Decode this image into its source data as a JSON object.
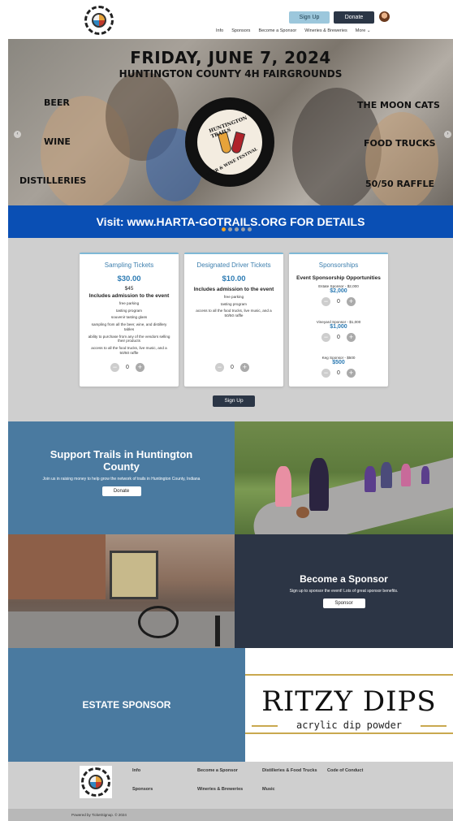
{
  "header": {
    "signup_label": "Sign Up",
    "donate_label": "Donate",
    "nav": [
      "Info",
      "Sponsors",
      "Become a Sponsor",
      "Wineries & Breweries",
      "More ⌄"
    ]
  },
  "hero": {
    "title": "FRIDAY, JUNE  7, 2024",
    "subtitle": "HUNTINGTON COUNTY 4H FAIRGROUNDS",
    "left": [
      "BEER",
      "WINE",
      "DISTILLERIES"
    ],
    "right": [
      "THE MOON CATS",
      "FOOD TRUCKS",
      "50/50 RAFFLE"
    ],
    "badge_top": "HUNTINGTON TRAILS",
    "badge_bottom": "BEER & WINE FESTIVAL",
    "banner": "Visit: www.HARTA-GOTRAILS.ORG FOR DETAILS",
    "slides": 5,
    "active_slide": 1
  },
  "tickets": {
    "sampling": {
      "title": "Sampling Tickets",
      "price": "$30.00",
      "sub": "$45",
      "head": "Includes admission to the event",
      "items": [
        "free parking",
        "tasting program",
        "souvenir tasting glass",
        "sampling from all the beer, wine, and distillery tables",
        "ability to purchase from any of the vendors selling their products",
        "access to all the food trucks, live music, and a 50/50 raffle"
      ],
      "qty": "0"
    },
    "driver": {
      "title": "Designated Driver Tickets",
      "price": "$10.00",
      "head": "Includes admission to the event",
      "items": [
        "free parking",
        "tasting program",
        "access to all the food trucks, live music, and a 50/50 raffle"
      ],
      "qty": "0"
    },
    "sponsorships": {
      "title": "Sponsorships",
      "head": "Event Sponsorship Opportunities",
      "levels": [
        {
          "label": "Estate Sponsor - $2,000",
          "price": "$2,000",
          "qty": "0"
        },
        {
          "label": "Vineyard Sponsor - $1,000",
          "price": "$1,000",
          "qty": "0"
        },
        {
          "label": "Keg Sponsor - $500",
          "price": "$500",
          "qty": "0"
        }
      ]
    },
    "signup_label": "Sign Up"
  },
  "support": {
    "title": "Support Trails in Huntington County",
    "text": "Join us in raising money to help grow the network of trails in Huntington County, Indiana",
    "button": "Donate"
  },
  "become": {
    "title": "Become a Sponsor",
    "text": "Sign up to sponsor the event! Lots of great sponsor benefits.",
    "button": "Sponsor"
  },
  "estate": {
    "label": "ESTATE SPONSOR",
    "sponsor_name": "RITZY DIPS",
    "sponsor_tagline": "acrylic dip powder"
  },
  "footer": {
    "col1": [
      "Info",
      "Sponsors"
    ],
    "col2": [
      "Become a Sponsor",
      "Wineries & Breweries"
    ],
    "col3": [
      "Distilleries & Food Trucks",
      "Music"
    ],
    "col4": [
      "Code of Conduct"
    ],
    "powered": "Powered by TicketSignup. © 2024"
  },
  "colors": {
    "accent_blue": "#2d7bb3",
    "banner_blue": "#0a4fb4",
    "dark_button": "#2b3646",
    "light_button": "#9cc7dc",
    "section_blue": "#4a7aa0",
    "section_dark": "#2c3545"
  }
}
